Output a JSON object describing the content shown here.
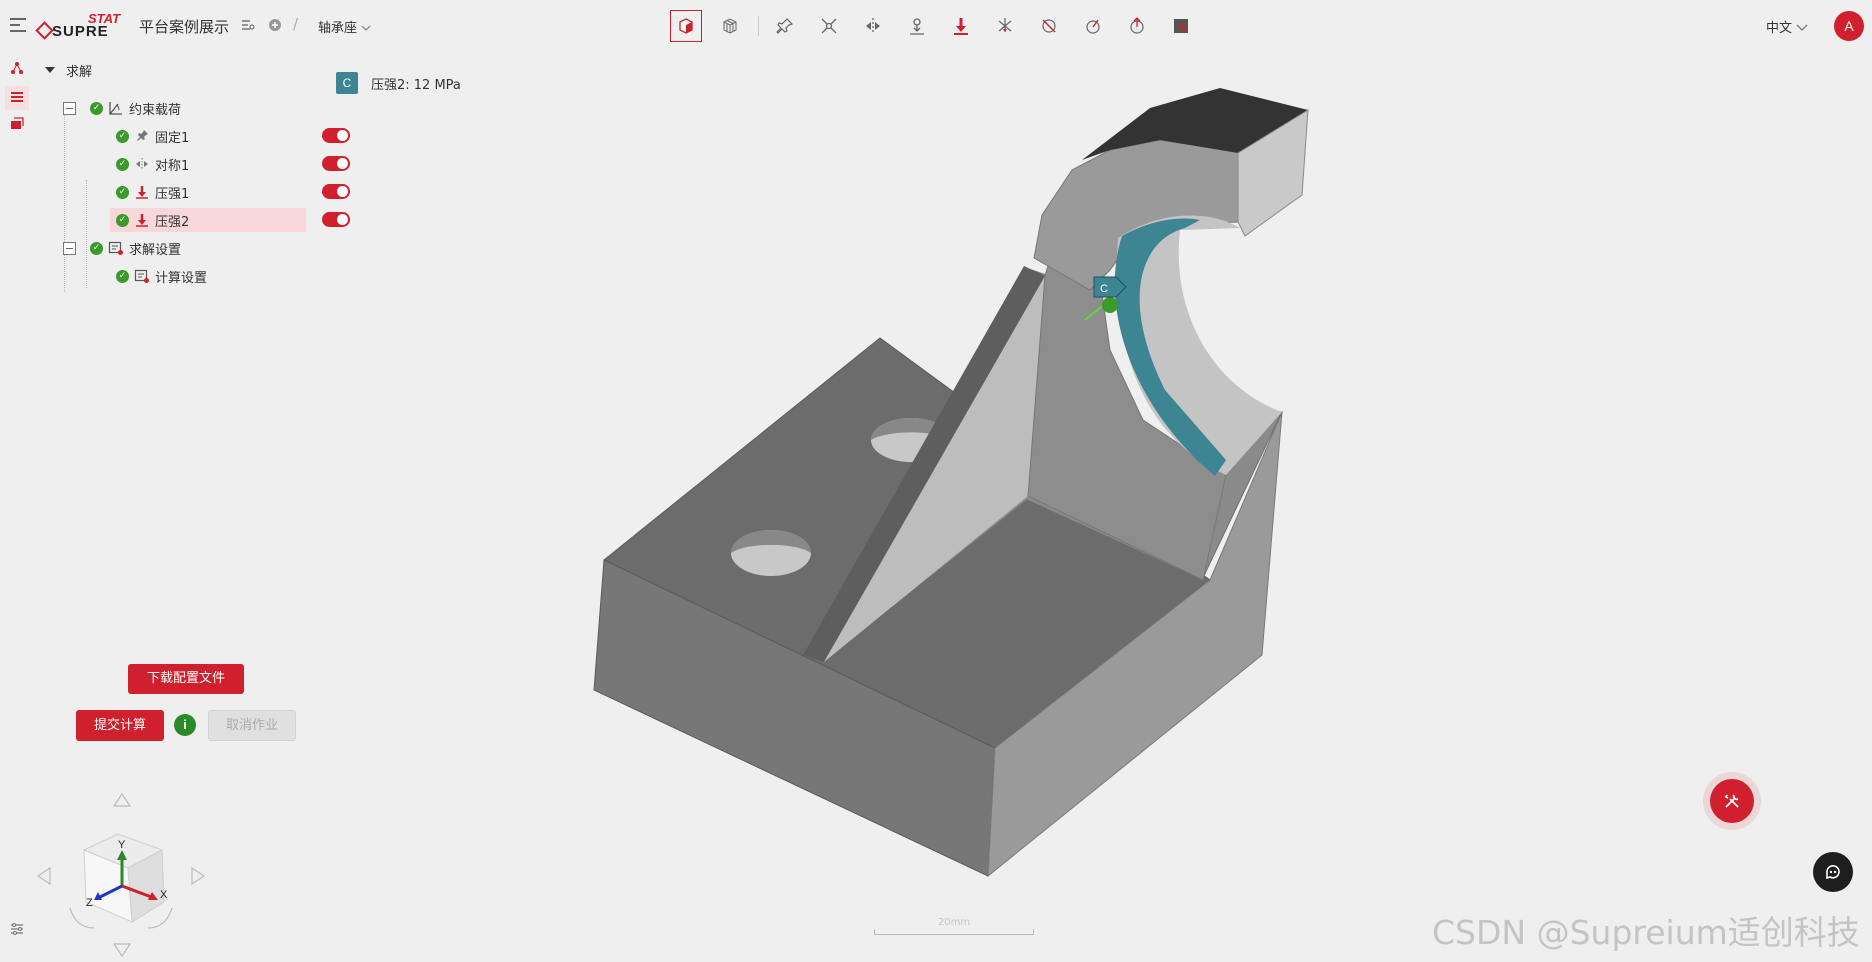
{
  "app": {
    "logo_text_top": "STAT",
    "logo_text_main": "SUPRE",
    "project_title": "平台案例展示",
    "model_name": "轴承座",
    "language": "中文",
    "user_initial": "A",
    "accent_color": "#d0202e"
  },
  "toolbar": {
    "items": [
      {
        "name": "solid-view-icon",
        "active": true
      },
      {
        "name": "wireframe-view-icon"
      },
      {
        "name": "pin-fixed-icon"
      },
      {
        "name": "constraint-icon"
      },
      {
        "name": "symmetry-icon"
      },
      {
        "name": "displacement-icon"
      },
      {
        "name": "pressure-icon"
      },
      {
        "name": "load-icon"
      },
      {
        "name": "remote-force-icon"
      },
      {
        "name": "bolt-icon"
      },
      {
        "name": "bearing-icon"
      },
      {
        "name": "select-icon"
      }
    ]
  },
  "rail": {
    "items": [
      {
        "name": "geometry-icon"
      },
      {
        "name": "tree-list-icon",
        "active": true
      },
      {
        "name": "results-icon"
      }
    ]
  },
  "tree": {
    "root": "求解",
    "groups": [
      {
        "label": "约束载荷",
        "items": [
          {
            "label": "固定1",
            "enabled": true
          },
          {
            "label": "对称1",
            "enabled": true
          },
          {
            "label": "压强1",
            "enabled": true
          },
          {
            "label": "压强2",
            "enabled": true,
            "selected": true
          }
        ]
      },
      {
        "label": "求解设置",
        "items": [
          {
            "label": "计算设置"
          }
        ]
      }
    ]
  },
  "actions": {
    "download_config": "下载配置文件",
    "submit": "提交计算",
    "info": "i",
    "cancel_job": "取消作业"
  },
  "viewport": {
    "badge": "C",
    "load_label": "压强2: 12 MPa",
    "marker_label": "C",
    "scale_label": "20mm",
    "axis_x": "X",
    "axis_y": "Y",
    "axis_z": "Z"
  },
  "watermark": "CSDN @Supreium适创科技"
}
